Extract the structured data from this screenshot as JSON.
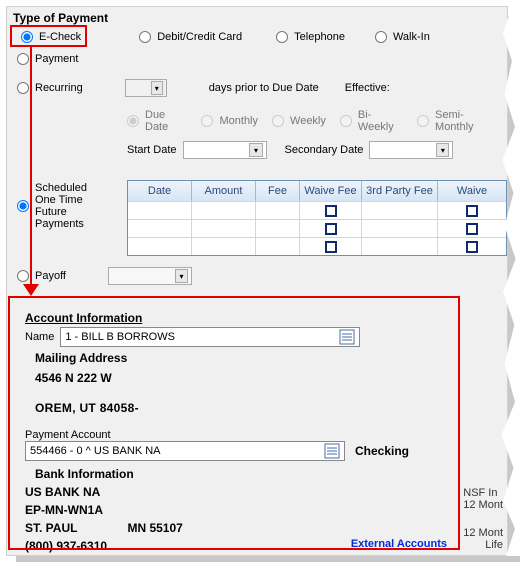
{
  "group_title": "Type of Payment",
  "payment_types": {
    "echeck": "E-Check",
    "debit": "Debit/Credit Card",
    "telephone": "Telephone",
    "walkin": "Walk-In",
    "payment": "Payment",
    "recurring": "Recurring",
    "scheduled": "Scheduled One Time Future Payments",
    "payoff": "Payoff"
  },
  "recurring": {
    "days_label": "days prior to Due Date",
    "effective_label": "Effective:",
    "due_date": "Due Date",
    "monthly": "Monthly",
    "weekly": "Weekly",
    "biweekly": "Bi-Weekly",
    "semimonthly": "Semi-Monthly",
    "start_date": "Start Date",
    "secondary_date": "Secondary Date"
  },
  "table": {
    "headers": [
      "Date",
      "Amount",
      "Fee",
      "Waive Fee",
      "3rd Party Fee",
      "Waive"
    ]
  },
  "account": {
    "title": "Account Information",
    "name_label": "Name",
    "name_value": "1 - BILL B BORROWS",
    "mailing_title": "Mailing Address",
    "addr1": "4546 N 222 W",
    "addr2": "OREM, UT  84058-",
    "pa_label": "Payment Account",
    "pa_value": "554466 - 0 ^ US BANK NA",
    "pa_type": "Checking",
    "bank_title": "Bank Information",
    "bank_name": "US BANK NA",
    "bank_code": "EP-MN-WN1A",
    "bank_city": "ST. PAUL",
    "bank_zip": "MN 55107",
    "bank_phone": "(800) 937-6310",
    "ext_link": "External Accounts"
  },
  "side": {
    "l1": "NSF In",
    "l2": "12 Mont",
    "l3": "12 Mont",
    "l4": "Life"
  }
}
